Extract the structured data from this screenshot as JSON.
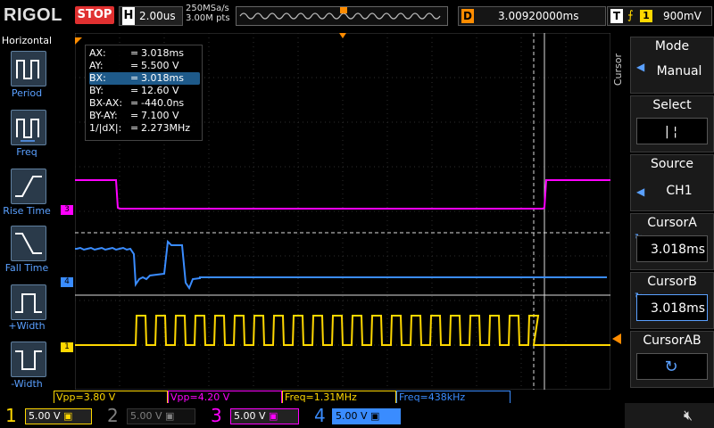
{
  "header": {
    "brand": "RIGOL",
    "run_state": "STOP",
    "timebase_letter": "H",
    "timebase": "2.00us",
    "sample_rate": "250MSa/s",
    "memory_depth": "3.00M pts",
    "delay_letter": "D",
    "delay": "3.00920000ms",
    "trigger_letter": "T",
    "trigger_icon": "rising-edge-icon",
    "trigger_source": "1",
    "trigger_level": "900mV"
  },
  "left_panel": {
    "title": "Horizontal",
    "items": [
      {
        "label": "Period"
      },
      {
        "label": "Freq"
      },
      {
        "label": "Rise Time"
      },
      {
        "label": "Fall Time"
      },
      {
        "label": "+Width"
      },
      {
        "label": "-Width"
      }
    ]
  },
  "cursor_panel": {
    "vertical_label": "Cursor",
    "mode_title": "Mode",
    "mode_value": "Manual",
    "select_title": "Select",
    "select_value": "| ¦",
    "source_title": "Source",
    "source_value": "CH1",
    "cursora_title": "CursorA",
    "cursora_value": "3.018ms",
    "cursorb_title": "CursorB",
    "cursorb_value": "3.018ms",
    "cursorab_title": "CursorAB"
  },
  "cursor_readout": {
    "rows": [
      {
        "key": "AX:",
        "eq": "=",
        "val": "3.018ms"
      },
      {
        "key": "AY:",
        "eq": "=",
        "val": "5.500 V"
      },
      {
        "key": "BX:",
        "eq": "=",
        "val": "3.018ms"
      },
      {
        "key": "BY:",
        "eq": "=",
        "val": "12.60 V"
      },
      {
        "key": "BX-AX:",
        "eq": "=",
        "val": "-440.0ns"
      },
      {
        "key": "BY-AY:",
        "eq": "=",
        "val": "7.100 V"
      },
      {
        "key": "1/|dX|:",
        "eq": "=",
        "val": "2.273MHz"
      }
    ]
  },
  "measurements": [
    {
      "text": "Vpp=3.80 V",
      "color": "#ffd800"
    },
    {
      "text": "Vpp=4.20 V",
      "color": "#ff00ff"
    },
    {
      "text": "Freq=1.31MHz",
      "color": "#ffd800"
    },
    {
      "text": "Freq=438kHz",
      "color": "#3a8cff"
    }
  ],
  "channels": [
    {
      "num": "1",
      "scale": "5.00 V",
      "color": "#ffd800",
      "active": true
    },
    {
      "num": "2",
      "scale": "5.00 V",
      "color": "#808080",
      "active": false
    },
    {
      "num": "3",
      "scale": "5.00 V",
      "color": "#ff00ff",
      "active": true
    },
    {
      "num": "4",
      "scale": "5.00 V",
      "color": "#3a8cff",
      "active": true
    }
  ],
  "trace_markers": {
    "ch1": "1",
    "ch3": "3",
    "ch4": "4"
  },
  "colors": {
    "ch1": "#ffd800",
    "ch3": "#ff00ff",
    "ch4": "#3a8cff",
    "accent": "#ff8c00",
    "stop": "#e03030"
  }
}
